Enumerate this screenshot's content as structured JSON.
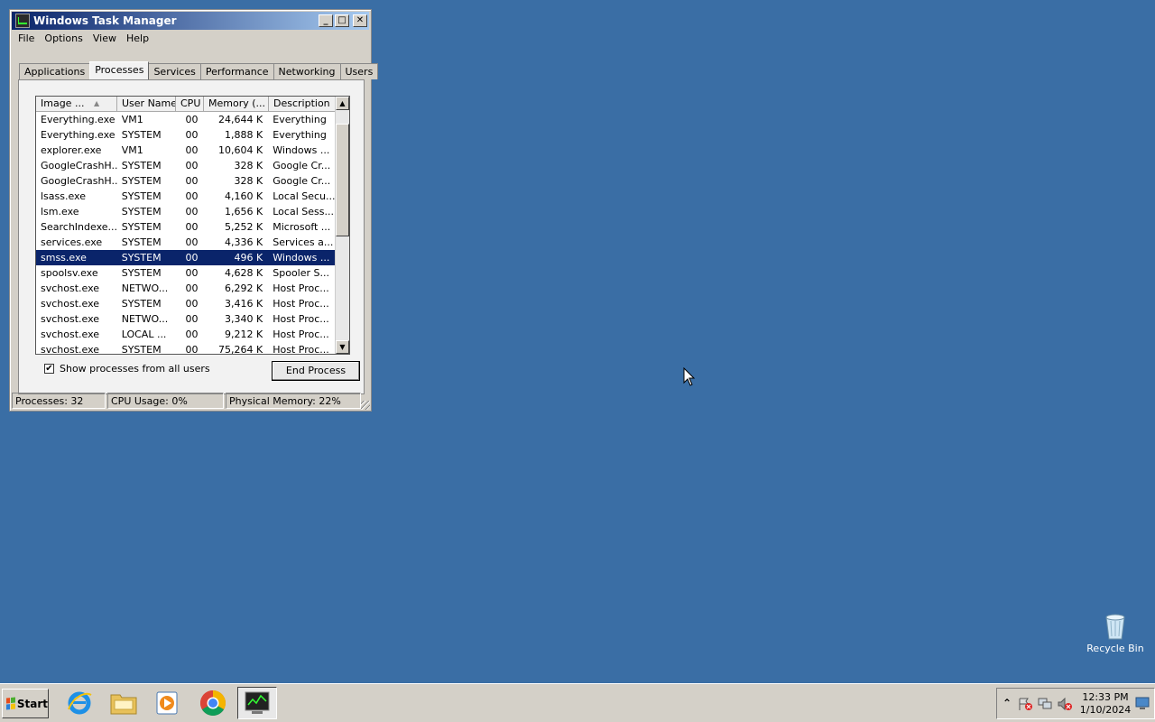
{
  "window": {
    "title": "Windows Task Manager",
    "buttons": {
      "minimize": "_",
      "maximize": "□",
      "close": "✕"
    }
  },
  "menu": [
    "File",
    "Options",
    "View",
    "Help"
  ],
  "tabs": [
    {
      "label": "Applications",
      "active": false
    },
    {
      "label": "Processes",
      "active": true
    },
    {
      "label": "Services",
      "active": false
    },
    {
      "label": "Performance",
      "active": false
    },
    {
      "label": "Networking",
      "active": false
    },
    {
      "label": "Users",
      "active": false
    }
  ],
  "processes": {
    "columns": [
      "Image ...",
      "User Name",
      "CPU",
      "Memory (...",
      "Description"
    ],
    "sort_arrow": "▲",
    "rows": [
      {
        "image": "Everything.exe",
        "user": "VM1",
        "cpu": "00",
        "memory": "24,644 K",
        "desc": "Everything",
        "selected": false
      },
      {
        "image": "Everything.exe",
        "user": "SYSTEM",
        "cpu": "00",
        "memory": "1,888 K",
        "desc": "Everything",
        "selected": false
      },
      {
        "image": "explorer.exe",
        "user": "VM1",
        "cpu": "00",
        "memory": "10,604 K",
        "desc": "Windows ...",
        "selected": false
      },
      {
        "image": "GoogleCrashH...",
        "user": "SYSTEM",
        "cpu": "00",
        "memory": "328 K",
        "desc": "Google Cr...",
        "selected": false
      },
      {
        "image": "GoogleCrashH...",
        "user": "SYSTEM",
        "cpu": "00",
        "memory": "328 K",
        "desc": "Google Cr...",
        "selected": false
      },
      {
        "image": "lsass.exe",
        "user": "SYSTEM",
        "cpu": "00",
        "memory": "4,160 K",
        "desc": "Local Secu...",
        "selected": false
      },
      {
        "image": "lsm.exe",
        "user": "SYSTEM",
        "cpu": "00",
        "memory": "1,656 K",
        "desc": "Local Sess...",
        "selected": false
      },
      {
        "image": "SearchIndexe...",
        "user": "SYSTEM",
        "cpu": "00",
        "memory": "5,252 K",
        "desc": "Microsoft ...",
        "selected": false
      },
      {
        "image": "services.exe",
        "user": "SYSTEM",
        "cpu": "00",
        "memory": "4,336 K",
        "desc": "Services a...",
        "selected": false
      },
      {
        "image": "smss.exe",
        "user": "SYSTEM",
        "cpu": "00",
        "memory": "496 K",
        "desc": "Windows ...",
        "selected": true
      },
      {
        "image": "spoolsv.exe",
        "user": "SYSTEM",
        "cpu": "00",
        "memory": "4,628 K",
        "desc": "Spooler S...",
        "selected": false
      },
      {
        "image": "svchost.exe",
        "user": "NETWO...",
        "cpu": "00",
        "memory": "6,292 K",
        "desc": "Host Proc...",
        "selected": false
      },
      {
        "image": "svchost.exe",
        "user": "SYSTEM",
        "cpu": "00",
        "memory": "3,416 K",
        "desc": "Host Proc...",
        "selected": false
      },
      {
        "image": "svchost.exe",
        "user": "NETWO...",
        "cpu": "00",
        "memory": "3,340 K",
        "desc": "Host Proc...",
        "selected": false
      },
      {
        "image": "svchost.exe",
        "user": "LOCAL ...",
        "cpu": "00",
        "memory": "9,212 K",
        "desc": "Host Proc...",
        "selected": false
      },
      {
        "image": "svchost.exe",
        "user": "SYSTEM",
        "cpu": "00",
        "memory": "75,264 K",
        "desc": "Host Proc...",
        "selected": false
      }
    ]
  },
  "show_all_users": {
    "label": "Show processes from all users",
    "checked": true,
    "mark": "✔"
  },
  "end_process_label": "End Process",
  "status": {
    "processes": "Processes: 32",
    "cpu": "CPU Usage: 0%",
    "memory": "Physical Memory: 22%"
  },
  "desktop": {
    "recycle_bin_label": "Recycle Bin"
  },
  "taskbar": {
    "start_label": "Start",
    "pinned": [
      "internet-explorer-icon",
      "folder-icon",
      "media-player-icon",
      "chrome-icon",
      "task-manager-icon"
    ],
    "clock_time": "12:33 PM",
    "clock_date": "1/10/2024",
    "tray_expand": "⌃"
  },
  "colors": {
    "desktop": "#3a6ea5",
    "selection": "#0a246a"
  }
}
